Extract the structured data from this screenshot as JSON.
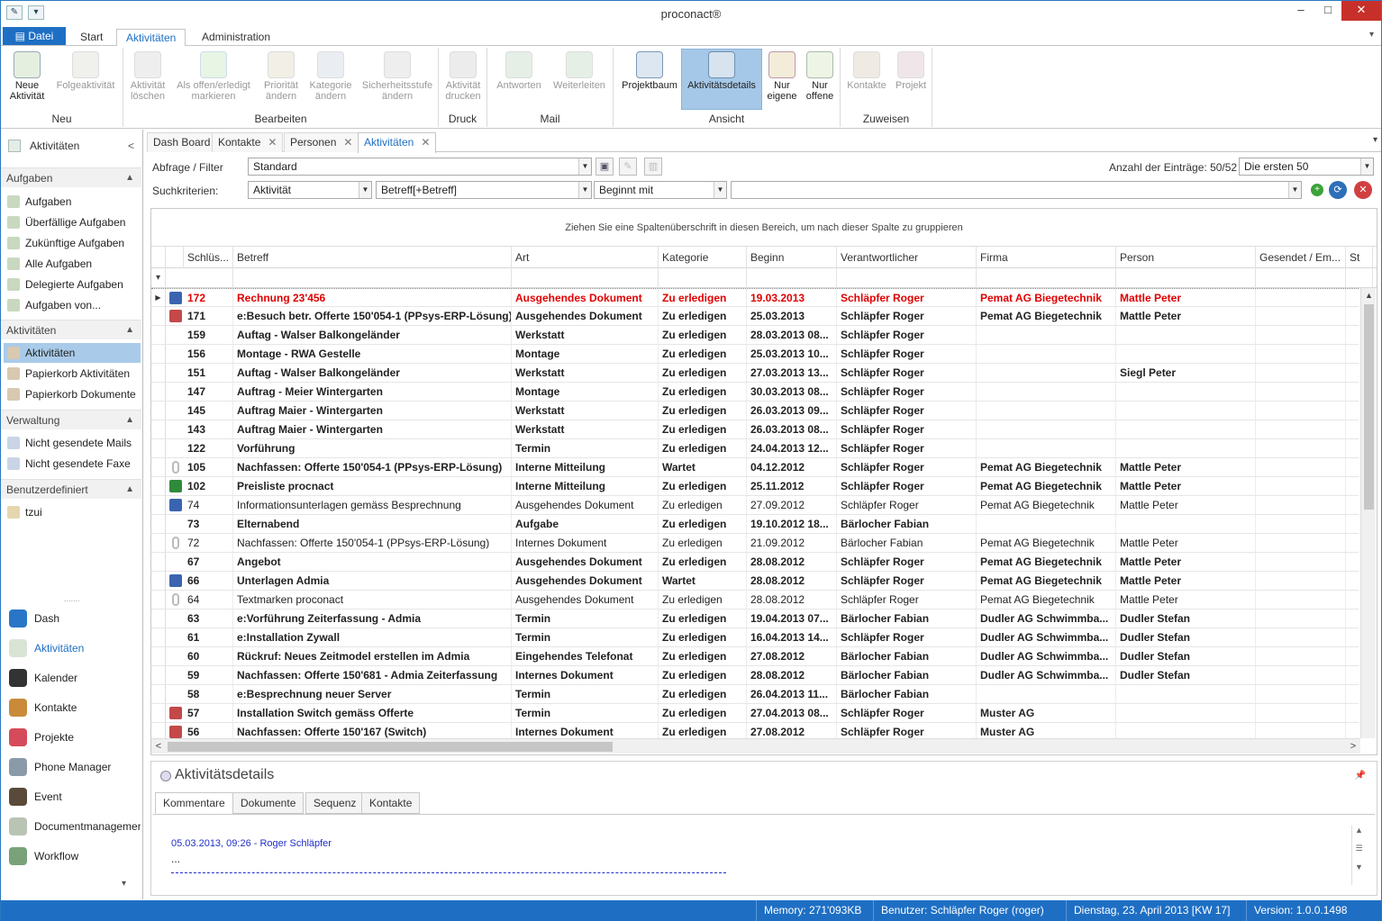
{
  "window": {
    "title": "proconact®"
  },
  "ribbon_tabs": {
    "file": "Datei",
    "tabs": [
      "Start",
      "Aktivitäten",
      "Administration"
    ],
    "active": 1
  },
  "ribbon": {
    "groups": [
      {
        "label": "Neu",
        "buttons": [
          {
            "label": "Neue Aktivität",
            "enabled": true
          },
          {
            "label": "Folgeaktivität",
            "enabled": false
          }
        ]
      },
      {
        "label": "Bearbeiten",
        "buttons": [
          {
            "label": "Aktivität löschen",
            "enabled": false
          },
          {
            "label": "Als offen/erledigt markieren",
            "enabled": false
          },
          {
            "label": "Priorität ändern",
            "enabled": false
          },
          {
            "label": "Kategorie ändern",
            "enabled": false
          },
          {
            "label": "Sicherheitsstufe ändern",
            "enabled": false
          }
        ]
      },
      {
        "label": "Druck",
        "buttons": [
          {
            "label": "Aktivität drucken",
            "enabled": false
          }
        ]
      },
      {
        "label": "Mail",
        "buttons": [
          {
            "label": "Antworten",
            "enabled": false
          },
          {
            "label": "Weiterleiten",
            "enabled": false
          }
        ]
      },
      {
        "label": "Ansicht",
        "buttons": [
          {
            "label": "Projektbaum",
            "enabled": true
          },
          {
            "label": "Aktivitätsdetails",
            "enabled": true,
            "selected": true
          },
          {
            "label": "Nur eigene",
            "enabled": true
          },
          {
            "label": "Nur offene",
            "enabled": true
          }
        ]
      },
      {
        "label": "Zuweisen",
        "buttons": [
          {
            "label": "Kontakte",
            "enabled": false
          },
          {
            "label": "Projekt",
            "enabled": false
          }
        ]
      }
    ]
  },
  "sidebar": {
    "header": "Aktivitäten",
    "sections": [
      {
        "title": "Aufgaben",
        "items": [
          "Aufgaben",
          "Überfällige Aufgaben",
          "Zukünftige Aufgaben",
          "Alle Aufgaben",
          "Delegierte Aufgaben",
          "Aufgaben von..."
        ]
      },
      {
        "title": "Aktivitäten",
        "items": [
          "Aktivitäten",
          "Papierkorb Aktivitäten",
          "Papierkorb Dokumente"
        ]
      },
      {
        "title": "Verwaltung",
        "items": [
          "Nicht gesendete Mails",
          "Nicht gesendete Faxe"
        ]
      },
      {
        "title": "Benutzerdefiniert",
        "items": [
          "tzui"
        ]
      }
    ],
    "nav": [
      "Dash",
      "Aktivitäten",
      "Kalender",
      "Kontakte",
      "Projekte",
      "Phone Manager",
      "Event",
      "Documentmanagement",
      "Workflow"
    ]
  },
  "doc_tabs": [
    "Dash Board",
    "Kontakte",
    "Personen",
    "Aktivitäten"
  ],
  "filter": {
    "query_label": "Abfrage / Filter",
    "query_value": "Standard",
    "count_label": "Anzahl der Einträge:",
    "count_value": "50/52",
    "count_select": "Die ersten 50",
    "criteria_label": "Suchkriterien:",
    "field": "Aktivität",
    "subfield": "Betreff[+Betreff]",
    "operator": "Beginnt mit",
    "value": ""
  },
  "grid": {
    "group_hint": "Ziehen Sie eine Spaltenüberschrift in diesen Bereich, um nach dieser Spalte zu gruppieren",
    "columns": [
      "Schlüs...",
      "Betreff",
      "Art",
      "Kategorie",
      "Beginn",
      "Verantwortlicher",
      "Firma",
      "Person",
      "Gesendet / Em...",
      "St"
    ],
    "rows": [
      {
        "icon": "doc",
        "style": "red",
        "cells": [
          "172",
          "Rechnung 23'456",
          "Ausgehendes Dokument",
          "Zu erledigen",
          "19.03.2013",
          "Schläpfer Roger",
          "Pemat AG Biegetechnik",
          "Mattle Peter",
          ""
        ]
      },
      {
        "icon": "calendar",
        "style": "bold",
        "cells": [
          "171",
          "e:Besuch betr. Offerte 150'054-1 (PPsys-ERP-Lösung)",
          "Ausgehendes Dokument",
          "Zu erledigen",
          "25.03.2013",
          "Schläpfer Roger",
          "Pemat AG Biegetechnik",
          "Mattle Peter",
          ""
        ]
      },
      {
        "icon": "",
        "style": "bold",
        "cells": [
          "159",
          "Auftag - Walser Balkongeländer",
          "Werkstatt",
          "Zu erledigen",
          "28.03.2013 08...",
          "Schläpfer Roger",
          "",
          "",
          ""
        ]
      },
      {
        "icon": "",
        "style": "bold",
        "cells": [
          "156",
          "Montage - RWA Gestelle",
          "Montage",
          "Zu erledigen",
          "25.03.2013 10...",
          "Schläpfer Roger",
          "",
          "",
          ""
        ]
      },
      {
        "icon": "",
        "style": "bold",
        "cells": [
          "151",
          "Auftag - Walser Balkongeländer",
          "Werkstatt",
          "Zu erledigen",
          "27.03.2013 13...",
          "Schläpfer Roger",
          "",
          "Siegl Peter",
          ""
        ]
      },
      {
        "icon": "",
        "style": "bold",
        "cells": [
          "147",
          "Auftrag - Meier Wintergarten",
          "Montage",
          "Zu erledigen",
          "30.03.2013 08...",
          "Schläpfer Roger",
          "",
          "",
          ""
        ]
      },
      {
        "icon": "",
        "style": "bold",
        "cells": [
          "145",
          "Auftrag Maier - Wintergarten",
          "Werkstatt",
          "Zu erledigen",
          "26.03.2013 09...",
          "Schläpfer Roger",
          "",
          "",
          ""
        ]
      },
      {
        "icon": "",
        "style": "bold",
        "cells": [
          "143",
          "Auftrag Maier - Wintergarten",
          "Werkstatt",
          "Zu erledigen",
          "26.03.2013 08...",
          "Schläpfer Roger",
          "",
          "",
          ""
        ]
      },
      {
        "icon": "",
        "style": "bold",
        "cells": [
          "122",
          "Vorführung",
          "Termin",
          "Zu erledigen",
          "24.04.2013 12...",
          "Schläpfer Roger",
          "",
          "",
          ""
        ]
      },
      {
        "icon": "clip",
        "style": "bold",
        "cells": [
          "105",
          "Nachfassen: Offerte 150'054-1 (PPsys-ERP-Lösung)",
          "Interne Mitteilung",
          "Wartet",
          "04.12.2012",
          "Schläpfer Roger",
          "Pemat AG Biegetechnik",
          "Mattle Peter",
          ""
        ]
      },
      {
        "icon": "excel",
        "style": "bold",
        "cells": [
          "102",
          "Preisliste procnact",
          "Interne Mitteilung",
          "Zu erledigen",
          "25.11.2012",
          "Schläpfer Roger",
          "Pemat AG Biegetechnik",
          "Mattle Peter",
          ""
        ]
      },
      {
        "icon": "doc",
        "style": "normal",
        "cells": [
          "74",
          "Informationsunterlagen gemäss Besprechnung",
          "Ausgehendes Dokument",
          "Zu erledigen",
          "27.09.2012",
          "Schläpfer Roger",
          "Pemat AG Biegetechnik",
          "Mattle Peter",
          ""
        ]
      },
      {
        "icon": "",
        "style": "bold",
        "cells": [
          "73",
          "Elternabend",
          "Aufgabe",
          "Zu erledigen",
          "19.10.2012 18...",
          "Bärlocher Fabian",
          "",
          "",
          ""
        ]
      },
      {
        "icon": "clip",
        "style": "normal",
        "cells": [
          "72",
          "Nachfassen: Offerte 150'054-1 (PPsys-ERP-Lösung)",
          "Internes Dokument",
          "Zu erledigen",
          "21.09.2012",
          "Bärlocher Fabian",
          "Pemat AG Biegetechnik",
          "Mattle Peter",
          ""
        ]
      },
      {
        "icon": "",
        "style": "bold",
        "cells": [
          "67",
          "Angebot",
          "Ausgehendes Dokument",
          "Zu erledigen",
          "28.08.2012",
          "Schläpfer Roger",
          "Pemat AG Biegetechnik",
          "Mattle Peter",
          ""
        ]
      },
      {
        "icon": "doc",
        "style": "bold",
        "cells": [
          "66",
          "Unterlagen Admia",
          "Ausgehendes Dokument",
          "Wartet",
          "28.08.2012",
          "Schläpfer Roger",
          "Pemat AG Biegetechnik",
          "Mattle Peter",
          ""
        ]
      },
      {
        "icon": "clip",
        "style": "normal",
        "cells": [
          "64",
          "Textmarken proconact",
          "Ausgehendes Dokument",
          "Zu erledigen",
          "28.08.2012",
          "Schläpfer Roger",
          "Pemat AG Biegetechnik",
          "Mattle Peter",
          ""
        ]
      },
      {
        "icon": "",
        "style": "bold",
        "cells": [
          "63",
          "e:Vorführung Zeiterfassung - Admia",
          "Termin",
          "Zu erledigen",
          "19.04.2013 07...",
          "Bärlocher Fabian",
          "Dudler AG Schwimmba...",
          "Dudler Stefan",
          ""
        ]
      },
      {
        "icon": "",
        "style": "bold",
        "cells": [
          "61",
          "e:Installation Zywall",
          "Termin",
          "Zu erledigen",
          "16.04.2013 14...",
          "Schläpfer Roger",
          "Dudler AG Schwimmba...",
          "Dudler Stefan",
          ""
        ]
      },
      {
        "icon": "",
        "style": "bold",
        "cells": [
          "60",
          "Rückruf: Neues Zeitmodel erstellen im Admia",
          "Eingehendes Telefonat",
          "Zu erledigen",
          "27.08.2012",
          "Bärlocher Fabian",
          "Dudler AG Schwimmba...",
          "Dudler Stefan",
          ""
        ]
      },
      {
        "icon": "",
        "style": "bold",
        "cells": [
          "59",
          "Nachfassen: Offerte 150'681 - Admia Zeiterfassung",
          "Internes Dokument",
          "Zu erledigen",
          "28.08.2012",
          "Bärlocher Fabian",
          "Dudler AG Schwimmba...",
          "Dudler Stefan",
          ""
        ]
      },
      {
        "icon": "",
        "style": "bold",
        "cells": [
          "58",
          "e:Besprechnung neuer Server",
          "Termin",
          "Zu erledigen",
          "26.04.2013 11...",
          "Bärlocher Fabian",
          "",
          "",
          ""
        ]
      },
      {
        "icon": "calendar",
        "style": "bold",
        "cells": [
          "57",
          "Installation Switch gemäss Offerte",
          "Termin",
          "Zu erledigen",
          "27.04.2013 08...",
          "Schläpfer Roger",
          "Muster AG",
          "",
          ""
        ]
      },
      {
        "icon": "calendar",
        "style": "bold",
        "cells": [
          "56",
          "Nachfassen: Offerte 150'167 (Switch)",
          "Internes Dokument",
          "Zu erledigen",
          "27.08.2012",
          "Schläpfer Roger",
          "Muster AG",
          "",
          ""
        ]
      }
    ]
  },
  "details": {
    "title": "Aktivitätsdetails",
    "tabs": [
      "Kommentare",
      "Dokumente",
      "Sequenz",
      "Kontakte"
    ],
    "comment_meta": "05.03.2013, 09:26 - Roger Schläpfer",
    "comment_text": "..."
  },
  "statusbar": {
    "memory": "Memory: 271'093KB",
    "user": "Benutzer: Schläpfer Roger (roger)",
    "date": "Dienstag, 23. April 2013 [KW 17]",
    "version": "Version: 1.0.0.1498"
  }
}
